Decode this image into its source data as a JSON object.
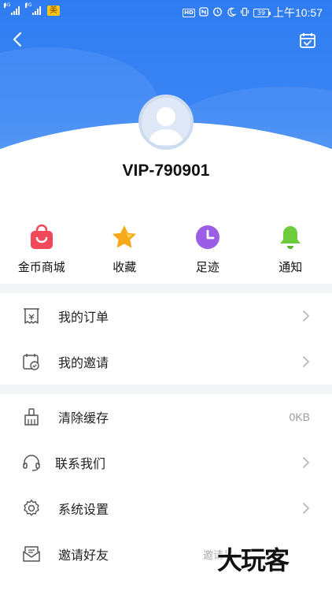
{
  "status_bar": {
    "signal1_tag": "4G",
    "signal2_tag": "3G",
    "app_badge": "美",
    "hd": "HD",
    "battery": "39",
    "time": "上午10:57"
  },
  "header": {
    "username": "VIP-790901",
    "back_icon": "chevron-left-icon",
    "calendar_icon": "calendar-check-icon"
  },
  "quick_actions": [
    {
      "label": "金币商城",
      "icon": "shopping-bag-icon",
      "color": "#f04a5a"
    },
    {
      "label": "收藏",
      "icon": "star-icon",
      "color": "#f7a81b"
    },
    {
      "label": "足迹",
      "icon": "clock-icon",
      "color": "#9b5de5"
    },
    {
      "label": "通知",
      "icon": "bell-icon",
      "color": "#6ccc3c"
    }
  ],
  "menu1": [
    {
      "label": "我的订单",
      "icon": "receipt-icon"
    },
    {
      "label": "我的邀请",
      "icon": "calendar-check-icon"
    }
  ],
  "menu2": [
    {
      "label": "清除缓存",
      "icon": "broom-icon",
      "value": "0KB"
    },
    {
      "label": "联系我们",
      "icon": "headset-icon"
    },
    {
      "label": "系统设置",
      "icon": "gear-icon"
    },
    {
      "label": "邀请好友",
      "icon": "mail-icon",
      "value": "邀请号:"
    }
  ],
  "watermark": "大玩客",
  "colors": {
    "header_blue": "#2f7cf2",
    "chevron": "#b5b5b5",
    "icon_gray": "#555555"
  }
}
